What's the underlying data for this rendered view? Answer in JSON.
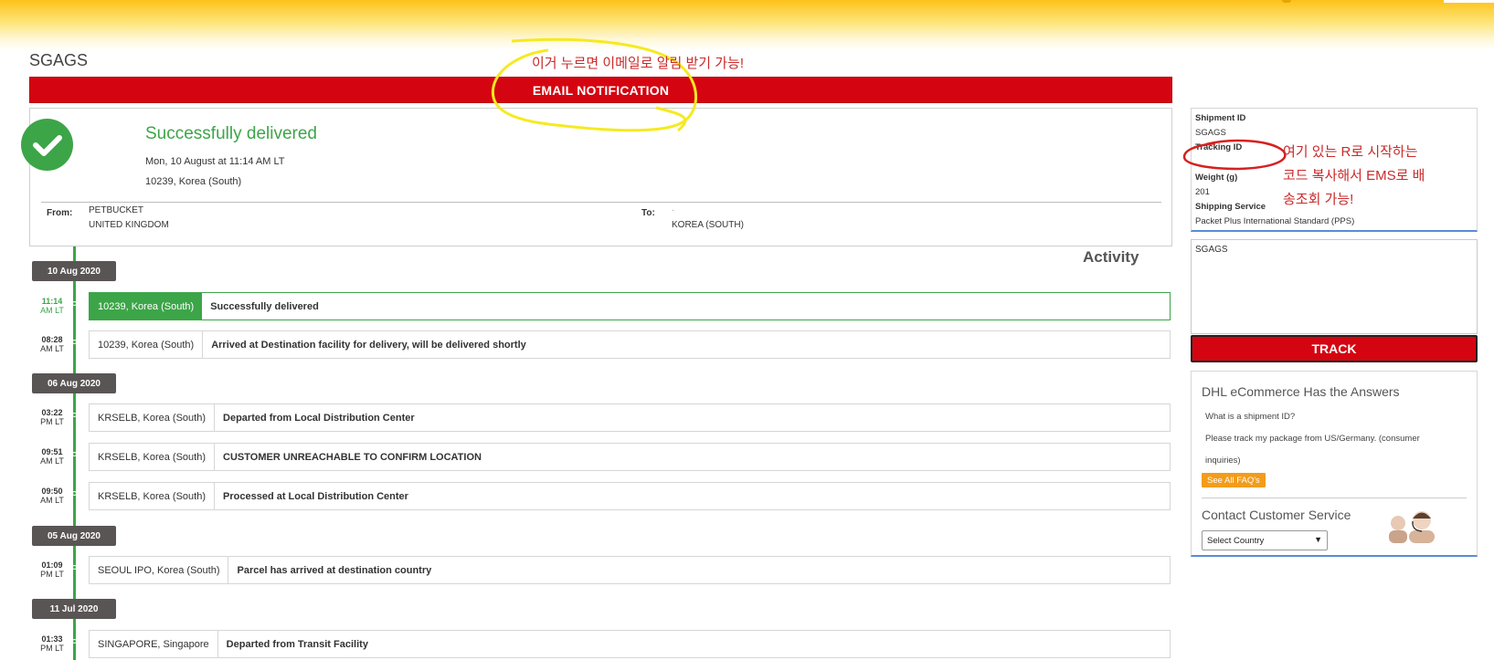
{
  "header": {
    "shipment_title": "SGAGS"
  },
  "email_notification": {
    "label": "EMAIL NOTIFICATION"
  },
  "summary": {
    "status": "Successfully delivered",
    "datetime": "Mon, 10 August at 11:14 AM LT",
    "location": "10239, Korea (South)",
    "from_label": "From:",
    "from_line1": "PETBUCKET",
    "from_line2": "UNITED KINGDOM",
    "to_label": "To:",
    "to_line1": "·",
    "to_line2": "KOREA (SOUTH)"
  },
  "activity": {
    "title": "Activity",
    "groups": [
      {
        "date": "10 Aug 2020",
        "events": [
          {
            "time": "11:14",
            "ampm": "AM LT",
            "location": "10239, Korea (South)",
            "description": "Successfully delivered",
            "active": true
          },
          {
            "time": "08:28",
            "ampm": "AM LT",
            "location": "10239, Korea (South)",
            "description": "Arrived at Destination facility for delivery, will be delivered shortly"
          }
        ]
      },
      {
        "date": "06 Aug 2020",
        "events": [
          {
            "time": "03:22",
            "ampm": "PM LT",
            "location": "KRSELB, Korea (South)",
            "description": "Departed from Local Distribution Center"
          },
          {
            "time": "09:51",
            "ampm": "AM LT",
            "location": "KRSELB, Korea (South)",
            "description": "CUSTOMER UNREACHABLE TO CONFIRM LOCATION"
          },
          {
            "time": "09:50",
            "ampm": "AM LT",
            "location": "KRSELB, Korea (South)",
            "description": "Processed at Local Distribution Center"
          }
        ]
      },
      {
        "date": "05 Aug 2020",
        "events": [
          {
            "time": "01:09",
            "ampm": "PM LT",
            "location": "SEOUL IPO, Korea (South)",
            "description": "Parcel has arrived at destination country"
          }
        ]
      },
      {
        "date": "11 Jul 2020",
        "events": [
          {
            "time": "01:33",
            "ampm": "PM LT",
            "location": "SINGAPORE, Singapore",
            "description": "Departed from Transit Facility"
          }
        ]
      }
    ]
  },
  "details": {
    "shipment_id_label": "Shipment ID",
    "shipment_id_value": "SGAGS",
    "tracking_id_label": "Tracking ID",
    "weight_label": "Weight (g)",
    "weight_value": "201",
    "service_label": "Shipping Service",
    "service_value": "Packet Plus International Standard (PPS)"
  },
  "track_form": {
    "textarea_value": "SGAGS",
    "button_label": "TRACK"
  },
  "faq": {
    "title": "DHL eCommerce Has the Answers",
    "q1": "What is a shipment ID?",
    "q2_line1": "Please track my package from US/Germany. (consumer",
    "q2_line2": "inquiries)",
    "all_button": "See All FAQ's",
    "contact_title": "Contact Customer Service",
    "country_select": "Select Country"
  },
  "annotations": {
    "email_note": "이거 누르면 이메일로 알림 받기 가능!",
    "tracking_note_line1": "여기 있는 R로 시작하는",
    "tracking_note_line2": "코드 복사해서 EMS로 배",
    "tracking_note_line3": "송조회 가능!",
    "yellow_color": "#f5ea1f",
    "red_color": "#d62020"
  },
  "colors": {
    "dhl_red": "#d40511",
    "dhl_yellow": "#fdc21a",
    "success_green": "#3ca548",
    "date_badge": "#5a5555"
  }
}
